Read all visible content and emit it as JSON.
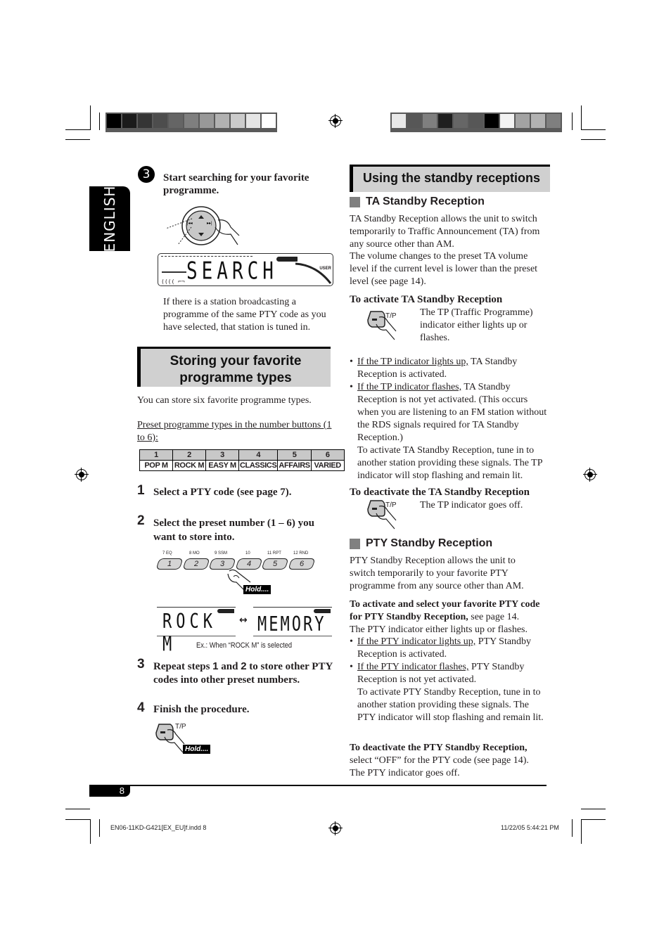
{
  "colorbar_left": [
    "#000000",
    "#1b1b1b",
    "#353535",
    "#4d4d4d",
    "#656565",
    "#7f7f7f",
    "#989898",
    "#b1b1b1",
    "#cbcbcb",
    "#e5e5e5",
    "#ffffff"
  ],
  "colorbar_right": [
    "#e8e8e8",
    "#575757",
    "#7f7f7f",
    "#1f1f1f",
    "#666666",
    "#575757",
    "#000000",
    "#f2f2f2",
    "#a3a3a3",
    "#b2b2b2",
    "#7f7f7f"
  ],
  "language_tab": "ENGLISH",
  "left": {
    "step3_marker": "3",
    "step3_title": "Start searching for your favorite programme.",
    "lcd_search": "SEARCH",
    "lcd_user": "USER",
    "step3_body": "If there is a station broadcasting a programme of the same PTY code as you have selected, that station is tuned in.",
    "storing_heading": "Storing your favorite programme types",
    "storing_intro": "You can store six favorite programme types.",
    "preset_caption": "Preset programme types in the number buttons (1 to 6):",
    "preset_table": {
      "numbers": [
        "1",
        "2",
        "3",
        "4",
        "5",
        "6"
      ],
      "types": [
        "POP M",
        "ROCK M",
        "EASY M",
        "CLASSICS",
        "AFFAIRS",
        "VARIED"
      ]
    },
    "steps": [
      {
        "num": "1",
        "text": "Select a PTY code (see page 7)."
      },
      {
        "num": "2",
        "text": "Select the preset number (1 – 6) you want to store into."
      },
      {
        "num": "3",
        "text_a": "Repeat steps ",
        "b1": "1",
        "text_b": " and ",
        "b2": "2",
        "text_c": " to store other PTY codes into other preset numbers."
      },
      {
        "num": "4",
        "text": "Finish the procedure."
      }
    ],
    "preset_buttons": [
      {
        "label": "1",
        "sub": "7  EQ"
      },
      {
        "label": "2",
        "sub": "8  MO"
      },
      {
        "label": "3",
        "sub": "9  SSM"
      },
      {
        "label": "4",
        "sub": "10"
      },
      {
        "label": "5",
        "sub": "11  RPT"
      },
      {
        "label": "6",
        "sub": "12  RND"
      }
    ],
    "hold_label": "Hold....",
    "lcd_rock": "ROCK M",
    "lcd_memory": "MEMORY",
    "lcd_arrow": "↔",
    "example_caption": "Ex.: When “ROCK M” is selected",
    "tp_label": "T/P"
  },
  "right": {
    "heading": "Using the standby receptions",
    "ta": {
      "title": "TA Standby Reception",
      "intro1": "TA Standby Reception allows the unit to switch temporarily to Traffic Announcement (TA) from any source other than AM.",
      "intro2": "The volume changes to the preset TA volume level if the current level is lower than the preset level (see page 14).",
      "activate_title": "To activate TA Standby Reception",
      "activate_desc": "The TP (Traffic Programme) indicator either lights up or flashes.",
      "bullets": [
        {
          "u": "If the TP indicator lights up,",
          "rest": " TA Standby Reception is activated."
        },
        {
          "u": "If the TP indicator flashes,",
          "rest": " TA Standby Reception is not yet activated. (This occurs when you are listening to an FM station without the RDS signals required for TA Standby Reception.)",
          "extra": "To activate TA Standby Reception, tune in to another station providing these signals. The TP indicator will stop flashing and remain lit."
        }
      ],
      "deactivate_title": "To deactivate the TA Standby Reception",
      "deactivate_desc": "The TP indicator goes off."
    },
    "pty": {
      "title": "PTY Standby Reception",
      "intro": "PTY Standby Reception allows the unit to switch temporarily to your favorite PTY programme from any source other than AM.",
      "activate_bold": "To activate and select your favorite PTY code for PTY Standby Reception,",
      "activate_rest": " see page 14.",
      "indicator_line": "The PTY indicator either lights up or flashes.",
      "bullets": [
        {
          "u": "If the PTY indicator lights up,",
          "rest": " PTY Standby Reception is activated."
        },
        {
          "u": "If the PTY indicator flashes,",
          "rest": " PTY Standby Reception is not yet activated.",
          "extra": "To activate PTY Standby Reception, tune in to another station providing these signals. The PTY indicator will stop flashing and remain lit."
        }
      ],
      "deactivate_bold": "To deactivate the PTY Standby Reception,",
      "deactivate_rest": " select “OFF” for the PTY code (see page 14).",
      "deactivate_line2": "The PTY indicator goes off."
    },
    "tp_label": "T/P"
  },
  "footer": {
    "page_number": "8",
    "file_slug": "EN06-11KD-G421[EX_EU]f.indd   8",
    "timestamp": "11/22/05   5:44:21 PM"
  }
}
